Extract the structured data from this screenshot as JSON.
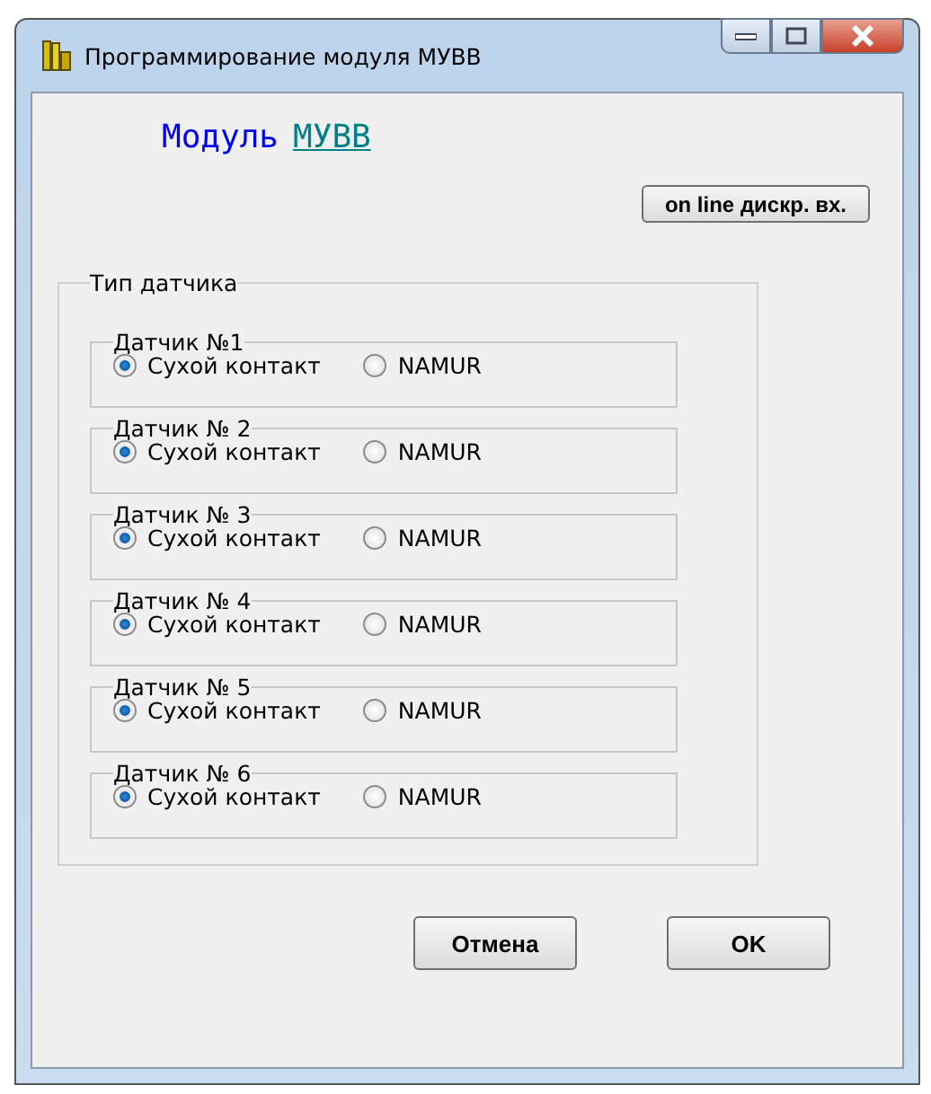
{
  "window": {
    "title": "Программирование модуля  МУВВ"
  },
  "heading": {
    "label": "Модуль",
    "link": "МУВВ"
  },
  "online_button": "on line дискр. вх.",
  "sensor_type": {
    "title": "Тип датчика",
    "sensors": [
      {
        "label": "Датчик №1",
        "options": [
          {
            "label": "Сухой контакт",
            "selected": true
          },
          {
            "label": "NAMUR",
            "selected": false
          }
        ]
      },
      {
        "label": "Датчик № 2",
        "options": [
          {
            "label": "Сухой контакт",
            "selected": true
          },
          {
            "label": "NAMUR",
            "selected": false
          }
        ]
      },
      {
        "label": "Датчик № 3",
        "options": [
          {
            "label": "Сухой контакт",
            "selected": true
          },
          {
            "label": "NAMUR",
            "selected": false
          }
        ]
      },
      {
        "label": "Датчик № 4",
        "options": [
          {
            "label": "Сухой контакт",
            "selected": true
          },
          {
            "label": "NAMUR",
            "selected": false
          }
        ]
      },
      {
        "label": "Датчик № 5",
        "options": [
          {
            "label": "Сухой контакт",
            "selected": true
          },
          {
            "label": "NAMUR",
            "selected": false
          }
        ]
      },
      {
        "label": "Датчик № 6",
        "options": [
          {
            "label": "Сухой контакт",
            "selected": true
          },
          {
            "label": "NAMUR",
            "selected": false
          }
        ]
      }
    ]
  },
  "buttons": [
    "Отмена",
    "OK"
  ]
}
